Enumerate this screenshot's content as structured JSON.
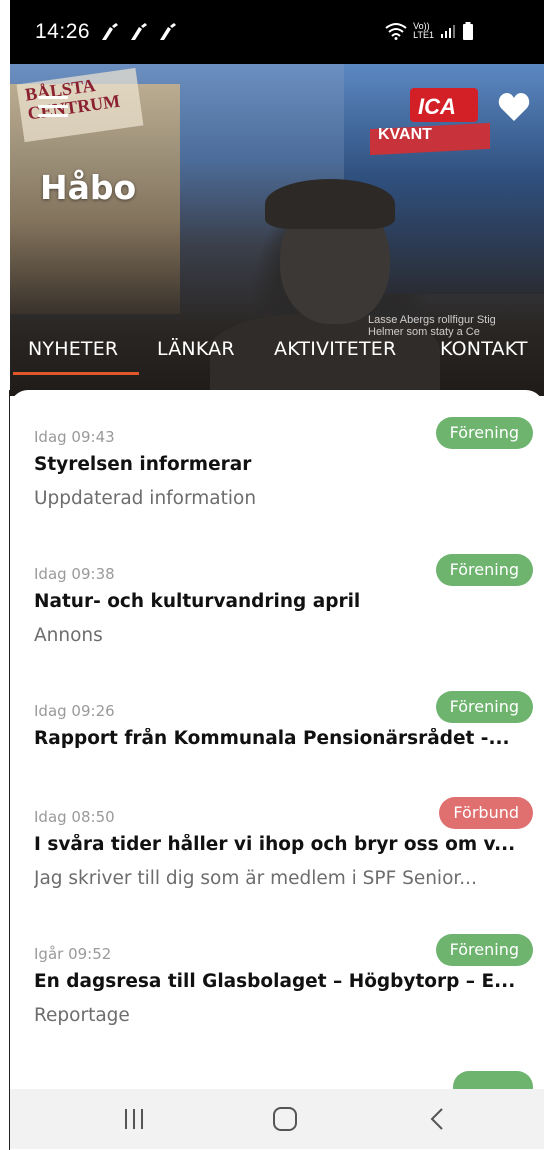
{
  "status_bar": {
    "time": "14:26",
    "notification_icons": [
      "broom-icon",
      "broom-icon",
      "broom-icon"
    ],
    "network_label_top": "Vo))",
    "network_label_bottom": "LTE1",
    "right_icons": [
      "wifi-icon",
      "signal-icon",
      "battery-icon"
    ]
  },
  "header": {
    "title": "Håbo",
    "hero_signs": {
      "balsta": "BÅLSTA CENTRUM",
      "ica": "ICA",
      "kvant": "KVANT"
    },
    "hero_caption": "Lasse Abergs rollfigur Stig Helmer som staty a Ce",
    "menu_icon": "hamburger-icon",
    "favorite_icon": "heart-icon"
  },
  "tabs": [
    {
      "label": "NYHETER",
      "active": true
    },
    {
      "label": "LÄNKAR",
      "active": false
    },
    {
      "label": "AKTIVITETER",
      "active": false
    },
    {
      "label": "KONTAKT",
      "active": false
    }
  ],
  "colors": {
    "accent": "#e0582a",
    "badge_forening": "#6eb46f",
    "badge_forbund": "#e06f6f"
  },
  "news": [
    {
      "time": "Idag 09:43",
      "badge": "Förening",
      "badge_type": "green",
      "title": "Styrelsen informerar",
      "subtitle": "Uppdaterad information"
    },
    {
      "time": "Idag 09:38",
      "badge": "Förening",
      "badge_type": "green",
      "title": "Natur- och kulturvandring april",
      "subtitle": "Annons"
    },
    {
      "time": "Idag 09:26",
      "badge": "Förening",
      "badge_type": "green",
      "title": "Rapport från Kommunala Pensionärsrådet -...",
      "subtitle": ""
    },
    {
      "time": "Idag 08:50",
      "badge": "Förbund",
      "badge_type": "red",
      "title": "I svåra tider håller vi ihop och bryr oss om v...",
      "subtitle": "Jag skriver till dig som är medlem i SPF Senior..."
    },
    {
      "time": "Igår 09:52",
      "badge": "Förening",
      "badge_type": "green",
      "title": "En dagsresa till Glasbolaget – Högbytorp – E...",
      "subtitle": "Reportage"
    }
  ],
  "navbar": {
    "icons": [
      "recents-icon",
      "home-icon",
      "back-icon"
    ]
  }
}
